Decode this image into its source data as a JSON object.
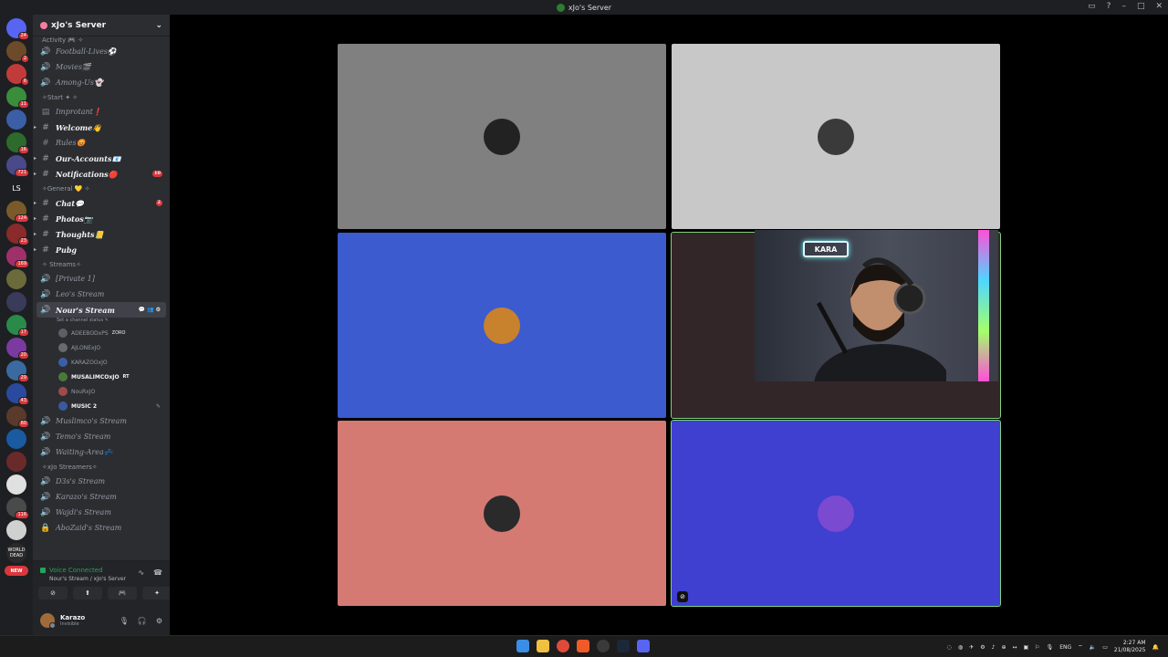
{
  "window": {
    "title": "xJo's Server"
  },
  "guilds": [
    {
      "badge": "24",
      "color": "#5865f2"
    },
    {
      "badge": "2",
      "color": "#6d4a2a"
    },
    {
      "badge": "6",
      "color": "#c23b3b"
    },
    {
      "badge": "11",
      "color": "#3a8d3a"
    },
    {
      "badge": "",
      "color": "#3b5fa6"
    },
    {
      "badge": "16",
      "color": "#2d6b2d"
    },
    {
      "badge": "721",
      "color": "#4a4a8a"
    },
    {
      "badge": "",
      "color": "#1e1f22",
      "text": "LS"
    },
    {
      "badge": "124",
      "color": "#7a5a2a"
    },
    {
      "badge": "23",
      "color": "#8a2a2a"
    },
    {
      "badge": "169",
      "color": "#a0306a"
    },
    {
      "badge": "",
      "color": "#6a6a3a"
    },
    {
      "badge": "",
      "color": "#3a3a5a"
    },
    {
      "badge": "17",
      "color": "#2a8a4a"
    },
    {
      "badge": "20",
      "color": "#7a3aa0"
    },
    {
      "badge": "29",
      "color": "#3a6aa0"
    },
    {
      "badge": "43",
      "color": "#2a4aa0"
    },
    {
      "badge": "60",
      "color": "#5a3a2a"
    },
    {
      "badge": "",
      "color": "#1a5aa0"
    },
    {
      "badge": "",
      "color": "#6a2a2a"
    },
    {
      "badge": "",
      "color": "#e0e0e0"
    },
    {
      "badge": "116",
      "color": "#4a4a4a"
    },
    {
      "badge": "",
      "color": "#d0d0d0"
    },
    {
      "badge": "",
      "color": "#2a2a2a",
      "text": "WORLD DEAD"
    }
  ],
  "guild_new_label": "NEW",
  "server": {
    "name": "xJo's Server"
  },
  "categories": {
    "activity": "Activity 🎮 ✧",
    "start": "✧Start ✦ ✧",
    "general": "✧General 💛 ✧",
    "streams": "✧ Streams✧",
    "streamers": "✧xJo Streamers✧"
  },
  "channels": {
    "football": "Football-Lives⚽",
    "movies": "Movies🎬",
    "amongus": "Among-Us👻",
    "important": "Improtant❗",
    "welcome": "Welcome👋",
    "rules": "Rules😡",
    "accounts": "Our-Accounts📧",
    "notifications": "Notifications🔴",
    "notifications_badge": "10",
    "chat": "Chat💬",
    "chat_badge": "2",
    "photos": "Photos📷",
    "thoughts": "Thoughts📒",
    "pubg": "Pubg",
    "private": "[Private 1]",
    "leo": "Leo's Stream",
    "nour": "Nour's Stream",
    "nour_status": "Set a channel status ✎",
    "muslimco": "Muslimco's Stream",
    "temo": "Temo's Stream",
    "waiting": "Waiting-Area💤",
    "d3s": "D3s's Stream",
    "karazo": "Karazo's Stream",
    "wajdi": "Wajdi's Stream",
    "abozaid": "AboZaid's Stream"
  },
  "members": [
    {
      "name": "ADEEBODxPS",
      "tag": "ZORO",
      "bright": false,
      "color": "#5c5f66"
    },
    {
      "name": "AJLONExJO",
      "tag": "",
      "bright": false,
      "color": "#6a6a6a"
    },
    {
      "name": "KARAZOOxJO",
      "tag": "",
      "bright": false,
      "color": "#3b5fa6"
    },
    {
      "name": "MUSALIMCOxJO",
      "tag": "RT",
      "bright": true,
      "color": "#4a7a3a"
    },
    {
      "name": "NouRxJO",
      "tag": "",
      "bright": false,
      "color": "#a04a4a"
    },
    {
      "name": "MUSIC 2",
      "tag": "",
      "bright": true,
      "color": "#3a5aa0"
    }
  ],
  "voice": {
    "status": "Voice Connected",
    "where": "Nour's Stream / xJo's Server"
  },
  "user": {
    "name": "Karazo",
    "status": "Invisible"
  },
  "tiles": [
    {
      "bg": "#808080",
      "avatar": "#222222"
    },
    {
      "bg": "#c8c8c8",
      "avatar": "#3a3a3a"
    },
    {
      "bg": "#3b5bcf",
      "avatar": "#c8812c"
    },
    {
      "bg": "#332629",
      "avatar": "#5a4a3a"
    },
    {
      "bg": "#d47a73",
      "avatar": "#2a2a2a"
    },
    {
      "bg": "#3f3fd0",
      "avatar": "#7a4ad0"
    }
  ],
  "webcam": {
    "neon_text": "KARA"
  },
  "taskbar": {
    "lang": "ENG",
    "time": "2:27 AM",
    "date": "21/08/2025"
  }
}
